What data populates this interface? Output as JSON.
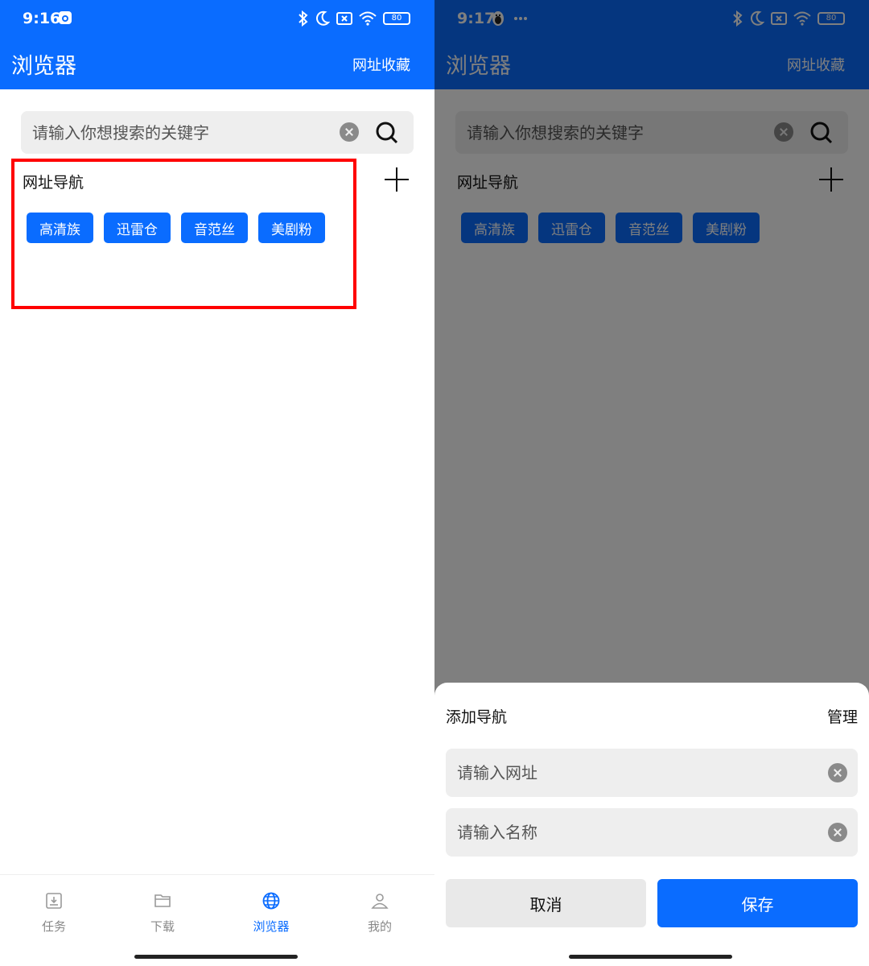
{
  "left": {
    "status": {
      "time": "9:16",
      "battery": "80"
    },
    "header": {
      "title": "浏览器",
      "link": "网址收藏"
    },
    "search": {
      "placeholder": "请输入你想搜索的关键字"
    },
    "nav": {
      "title": "网址导航",
      "tags": [
        "高清族",
        "迅雷仓",
        "音范丝",
        "美剧粉"
      ]
    },
    "bottom_nav": [
      {
        "label": "任务",
        "icon": "download-tray-icon"
      },
      {
        "label": "下载",
        "icon": "folder-icon"
      },
      {
        "label": "浏览器",
        "icon": "globe-icon",
        "active": true
      },
      {
        "label": "我的",
        "icon": "person-icon"
      }
    ]
  },
  "right": {
    "status": {
      "time": "9:17",
      "battery": "80"
    },
    "header": {
      "title": "浏览器",
      "link": "网址收藏"
    },
    "search": {
      "placeholder": "请输入你想搜索的关键字"
    },
    "nav": {
      "title": "网址导航",
      "tags": [
        "高清族",
        "迅雷仓",
        "音范丝",
        "美剧粉"
      ]
    },
    "sheet": {
      "title": "添加导航",
      "manage": "管理",
      "url_placeholder": "请输入网址",
      "name_placeholder": "请输入名称",
      "cancel": "取消",
      "save": "保存"
    }
  },
  "colors": {
    "primary": "#0a6cff",
    "highlight": "#ff0000",
    "overlay": "rgba(0,0,0,0.5)"
  }
}
